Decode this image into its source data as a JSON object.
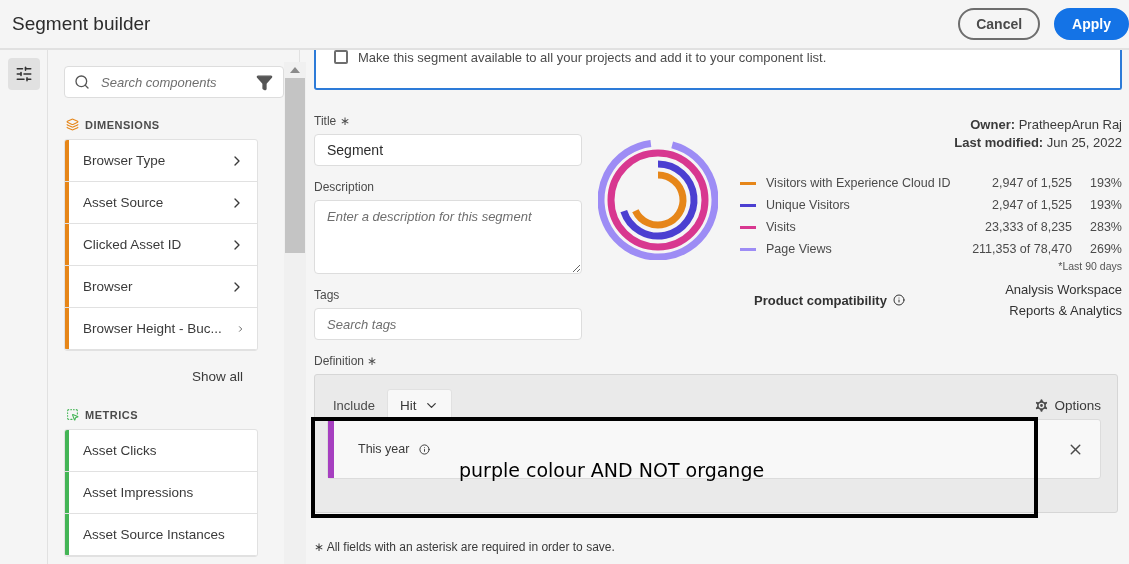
{
  "header": {
    "title": "Segment builder",
    "buttons": [
      {
        "label": "Cancel",
        "kind": "secondary"
      },
      {
        "label": "Apply",
        "kind": "primary"
      }
    ]
  },
  "rail": {
    "items": [
      {
        "selected": true
      }
    ]
  },
  "components": {
    "search": {
      "placeholder": "Search components"
    },
    "sections": [
      {
        "title": "DIMENSIONS",
        "kind": "dimension",
        "color": "#e68619",
        "items": [
          "Browser Type",
          "Asset Source",
          "Clicked Asset ID",
          "Browser",
          "Browser Height - Buc..."
        ],
        "show_all": "Show all"
      },
      {
        "title": "METRICS",
        "kind": "metric",
        "color": "#44b556",
        "items": [
          "Asset Clicks",
          "Asset Impressions",
          "Asset Source Instances"
        ]
      }
    ]
  },
  "share": {
    "checked": false,
    "label": "Make this segment available to all your projects and add it to your component list."
  },
  "form": {
    "title_label": "Title ∗",
    "title_value": "Segment",
    "description_label": "Description",
    "description_placeholder": "Enter a description for this segment",
    "tags_label": "Tags",
    "tags_placeholder": "Search tags",
    "definition_label": "Definition ∗"
  },
  "summary": {
    "owner_label": "Owner:",
    "owner": "PratheepArun Raj",
    "modified_label": "Last modified:",
    "modified": "Jun 25, 2022",
    "metrics": [
      {
        "name": "Visitors with Experience Cloud ID",
        "value": "2,947 of 1,525",
        "percent": "193%",
        "color": "#e68619"
      },
      {
        "name": "Unique Visitors",
        "value": "2,947 of 1,525",
        "percent": "193%",
        "color": "#4b3fd1"
      },
      {
        "name": "Visits",
        "value": "23,333 of 8,235",
        "percent": "283%",
        "color": "#d83790"
      },
      {
        "name": "Page Views",
        "value": "211,353 of 78,470",
        "percent": "269%",
        "color": "#9d8cf5"
      }
    ],
    "footnote": "*Last 90 days",
    "compatibility_label": "Product compatibility",
    "compatibility": [
      "Analysis Workspace",
      "Reports & Analytics"
    ]
  },
  "definition": {
    "include_label": "Include",
    "scope": "Hit",
    "options_label": "Options",
    "conditions": [
      {
        "label": "This year",
        "color": "#a63fc0"
      }
    ]
  },
  "annotation": {
    "text": "purple colour AND NOT organge"
  },
  "footer_note": "∗ All fields with an asterisk are required in order to save."
}
